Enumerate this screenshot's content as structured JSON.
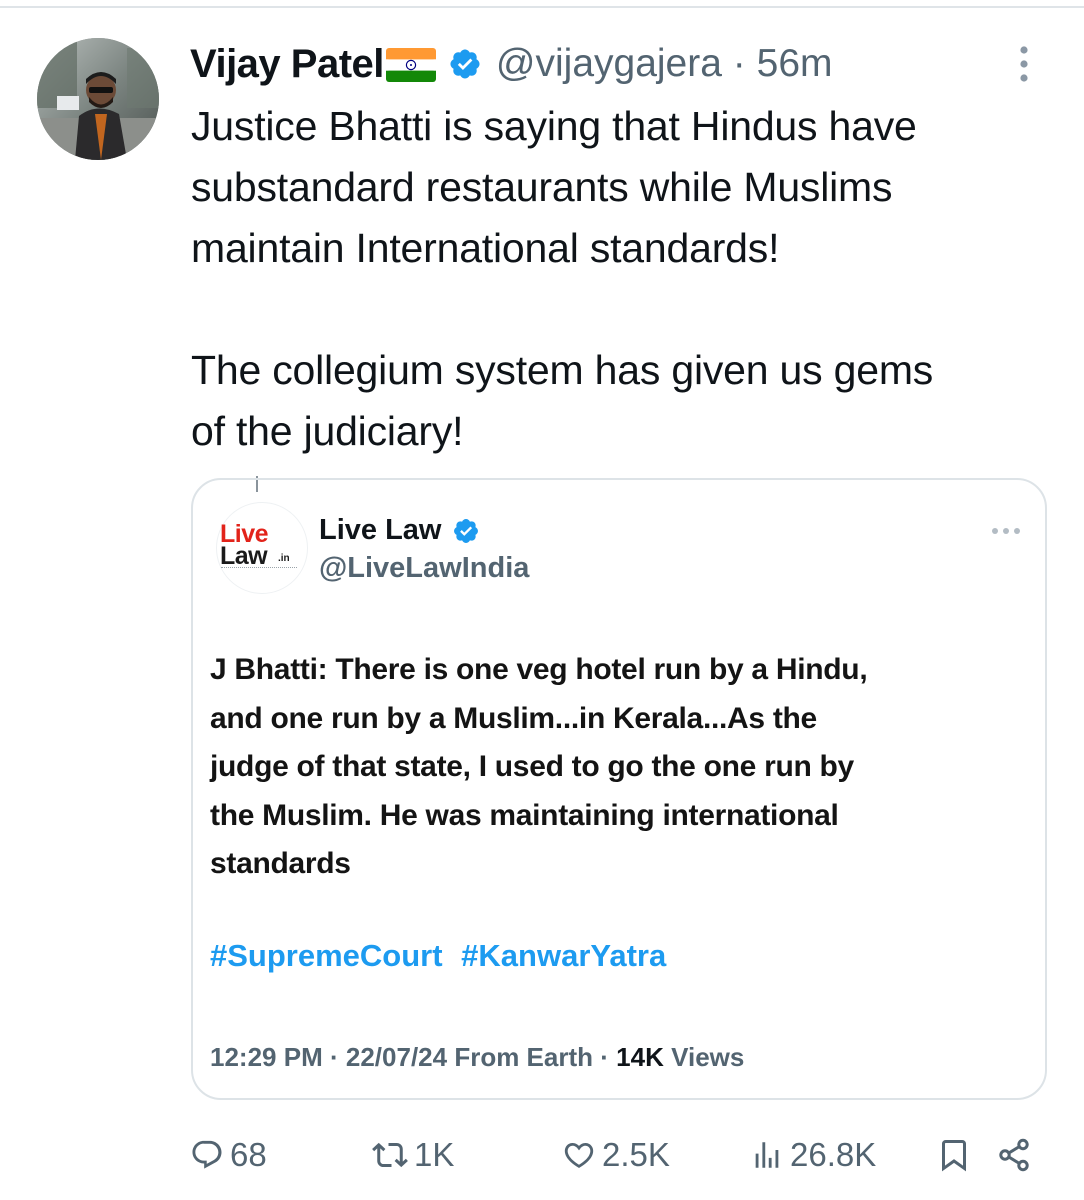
{
  "post": {
    "author": {
      "display_name": "Vijay Patel",
      "flag_emoji": "india-flag-icon",
      "verified": true,
      "handle": "@vijaygajera",
      "separator": "·",
      "time": "56m"
    },
    "text_paragraph_1": "Justice Bhatti is saying that Hindus have\nsubstandard restaurants while Muslims\nmaintain International standards!",
    "text_paragraph_2": "The collegium system has given us gems\nof the judiciary!",
    "more_icon": "more-vertical-icon"
  },
  "quote": {
    "avatar_text_live": "Live",
    "avatar_text_law": "Law",
    "avatar_text_in": ".in",
    "display_name": "Live Law",
    "verified": true,
    "handle": "@LiveLawIndia",
    "body": "J Bhatti: There is one veg hotel run by a Hindu,\nand one run by a Muslim...in Kerala...As the\njudge of that state, I used to go the one run by\nthe Muslim. He was maintaining international\nstandards",
    "hashtags": [
      "#SupremeCourt",
      "#KanwarYatra"
    ],
    "meta": {
      "time": "12:29 PM",
      "separator": "·",
      "date": "22/07/24",
      "source": "From Earth",
      "separator2": "·",
      "views_count": "14K",
      "views_label": "Views"
    }
  },
  "actions": {
    "replies": "68",
    "reposts": "1K",
    "likes": "2.5K",
    "views": "26.8K"
  },
  "colors": {
    "accent": "#1d9bf0",
    "secondary_text": "#536471",
    "primary_text": "#0f1419",
    "border": "#dde3e7",
    "live_red": "#e2231a"
  }
}
